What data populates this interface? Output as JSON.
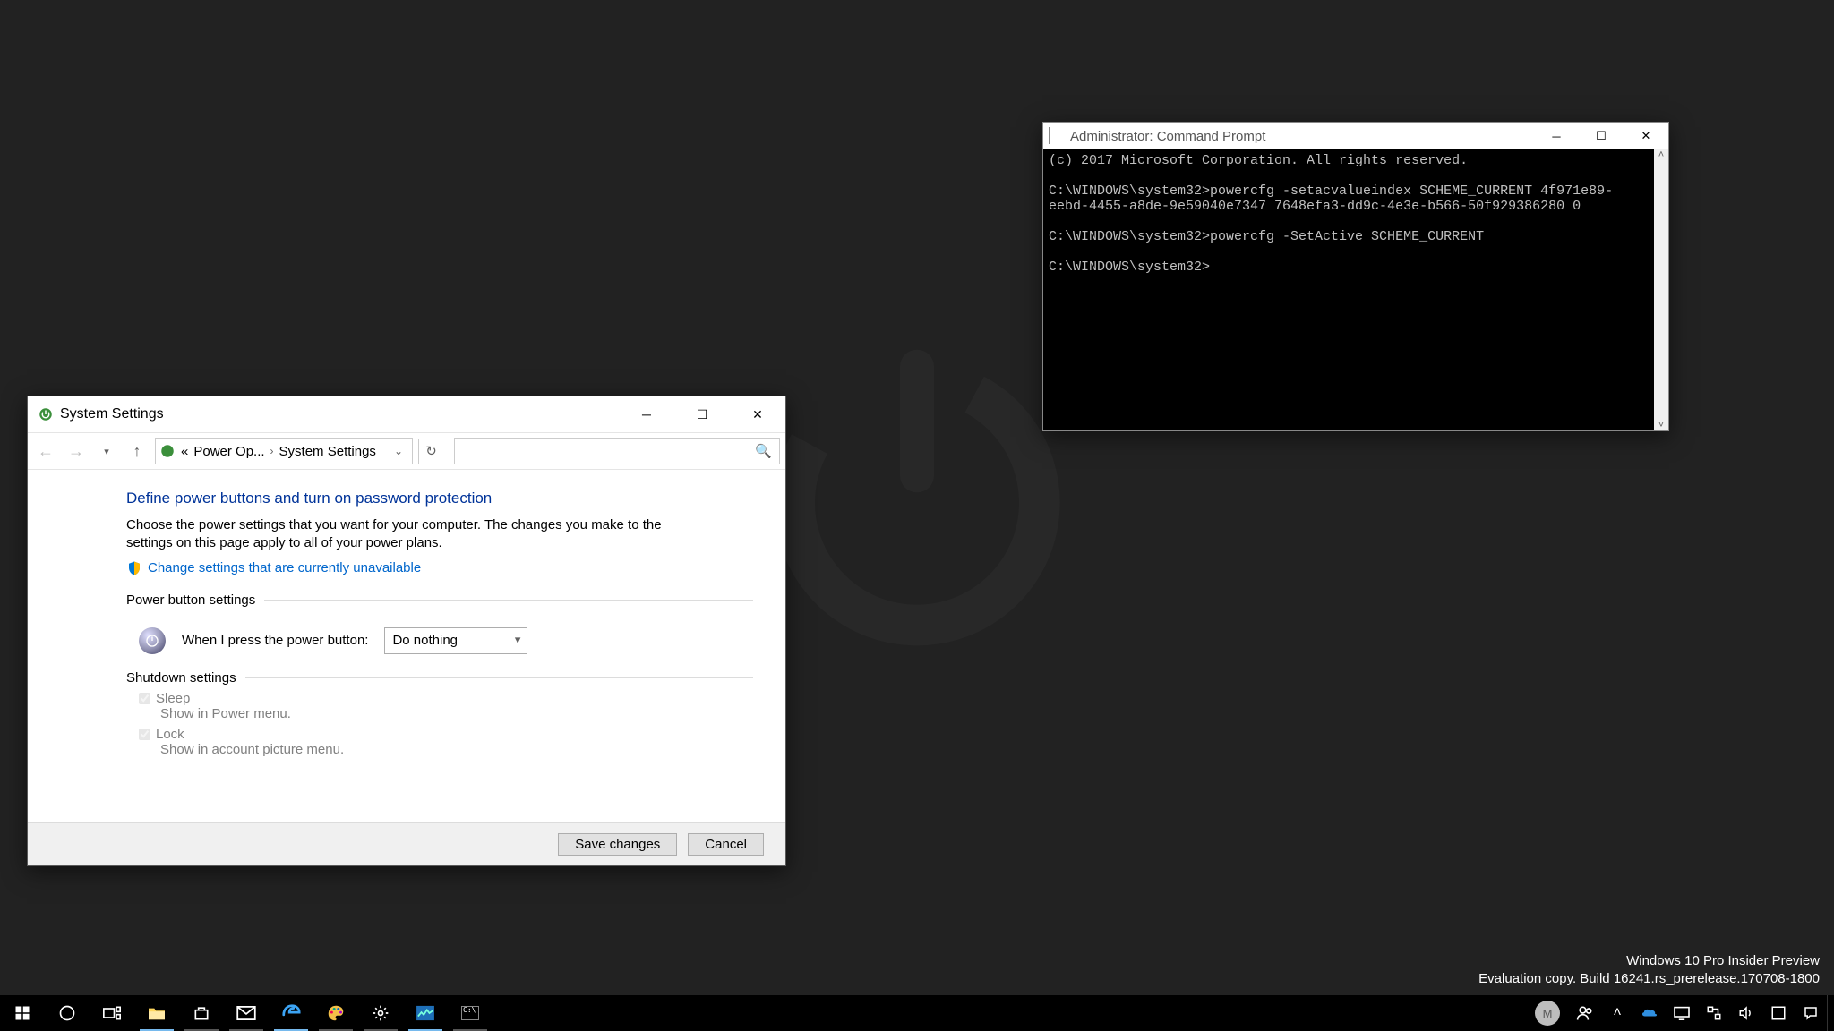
{
  "wallpaper": {
    "icon_name": "power-icon"
  },
  "system_settings_window": {
    "title": "System Settings",
    "breadcrumb": {
      "prefix": "«",
      "level1": "Power Op...",
      "level2": "System Settings"
    },
    "heading": "Define power buttons and turn on password protection",
    "description": "Choose the power settings that you want for your computer. The changes you make to the settings on this page apply to all of your power plans.",
    "uac_link": "Change settings that are currently unavailable",
    "section_power_button": "Power button settings",
    "power_button_label": "When I press the power button:",
    "power_button_value": "Do nothing",
    "section_shutdown": "Shutdown settings",
    "shutdown_items": [
      {
        "label": "Sleep",
        "sub": "Show in Power menu.",
        "checked": true
      },
      {
        "label": "Lock",
        "sub": "Show in account picture menu.",
        "checked": true
      }
    ],
    "buttons": {
      "save": "Save changes",
      "cancel": "Cancel"
    }
  },
  "cmd_window": {
    "title": "Administrator: Command Prompt",
    "lines": [
      "(c) 2017 Microsoft Corporation. All rights reserved.",
      "",
      "C:\\WINDOWS\\system32>powercfg -setacvalueindex SCHEME_CURRENT 4f971e89-eebd-4455-a8de-9e59040e7347 7648efa3-dd9c-4e3e-b566-50f929386280 0",
      "",
      "C:\\WINDOWS\\system32>powercfg -SetActive SCHEME_CURRENT",
      "",
      "C:\\WINDOWS\\system32>"
    ]
  },
  "watermark": {
    "l1": "Windows 10 Pro Insider Preview",
    "l2": "Evaluation copy. Build 16241.rs_prerelease.170708-1800"
  },
  "taskbar": {
    "left_icons": [
      "start",
      "cortana",
      "taskview",
      "explorer",
      "store",
      "mail",
      "edge",
      "paint",
      "settings",
      "task-manager",
      "cmd"
    ],
    "user_initial": "M",
    "tray_icons": [
      "people",
      "chevron-up",
      "onedrive",
      "compute",
      "network",
      "volume",
      "ime",
      "action-center"
    ]
  }
}
